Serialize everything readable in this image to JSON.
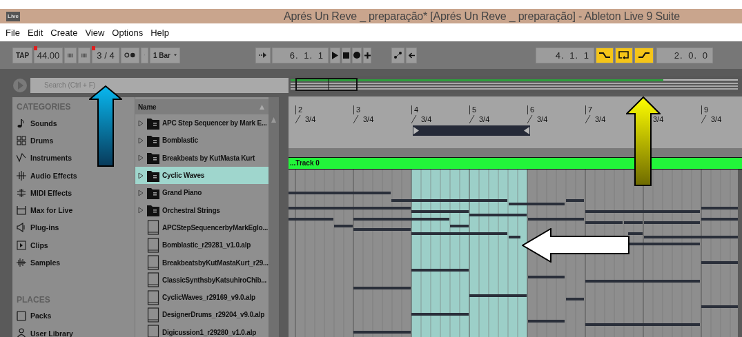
{
  "window": {
    "title": "Aprés Un Reve _ preparação*  [Aprés Un Reve _ preparação] - Ableton Live 9 Suite",
    "app_badge": "Live"
  },
  "menu": [
    "File",
    "Edit",
    "Create",
    "View",
    "Options",
    "Help"
  ],
  "transport": {
    "tap": "TAP",
    "tempo": "44.00",
    "signature": "3 / 4",
    "quantize": "1 Bar",
    "position": "6.  1.  1",
    "loop_start": "4.  1.  1",
    "loop_length": "2.  0.  0",
    "punch_in": {
      "on": true
    },
    "loop": {
      "on": true
    },
    "punch_out": {
      "on": true
    }
  },
  "browser": {
    "search": {
      "placeholder": "Search (Ctrl + F)"
    },
    "categories_heading": "CATEGORIES",
    "categories": [
      "Sounds",
      "Drums",
      "Instruments",
      "Audio Effects",
      "MIDI Effects",
      "Max for Live",
      "Plug-ins",
      "Clips",
      "Samples"
    ],
    "places_heading": "PLACES",
    "places": [
      "Packs",
      "User Library"
    ],
    "column": "Name",
    "files": [
      {
        "kind": "folder",
        "name": "APC Step Sequencer by Mark E...",
        "selected": false
      },
      {
        "kind": "folder",
        "name": "Bomblastic",
        "selected": false
      },
      {
        "kind": "folder",
        "name": "Breakbeats by KutMasta Kurt",
        "selected": false
      },
      {
        "kind": "folder",
        "name": "Cyclic Waves",
        "selected": true
      },
      {
        "kind": "folder",
        "name": "Grand Piano",
        "selected": false
      },
      {
        "kind": "folder",
        "name": "Orchestral Strings",
        "selected": false
      },
      {
        "kind": "file",
        "name": "APCStepSequencerbyMarkEglo...",
        "selected": false
      },
      {
        "kind": "file",
        "name": "Bomblastic_r29281_v1.0.alp",
        "selected": false
      },
      {
        "kind": "file",
        "name": "BreakbeatsbyKutMastaKurt_r29...",
        "selected": false
      },
      {
        "kind": "file",
        "name": "ClassicSynthsbyKatsuhiroChib...",
        "selected": false
      },
      {
        "kind": "file",
        "name": "CyclicWaves_r29169_v9.0.alp",
        "selected": false
      },
      {
        "kind": "file",
        "name": "DesignerDrums_r29204_v9.0.alp",
        "selected": false
      },
      {
        "kind": "file",
        "name": "Digicussion1_r29280_v1.0.alp",
        "selected": false
      }
    ]
  },
  "arrangement": {
    "markers": [
      {
        "bar": "2",
        "signature": "3/4"
      },
      {
        "bar": "3",
        "signature": "3/4"
      },
      {
        "bar": "4",
        "signature": "3/4"
      },
      {
        "bar": "5",
        "signature": "3/4"
      },
      {
        "bar": "6",
        "signature": "3/4"
      },
      {
        "bar": "7",
        "signature": "3/4"
      },
      {
        "signature": "3/4"
      },
      {
        "bar": "9",
        "signature": "3/4"
      }
    ],
    "track": "...Track 0"
  }
}
